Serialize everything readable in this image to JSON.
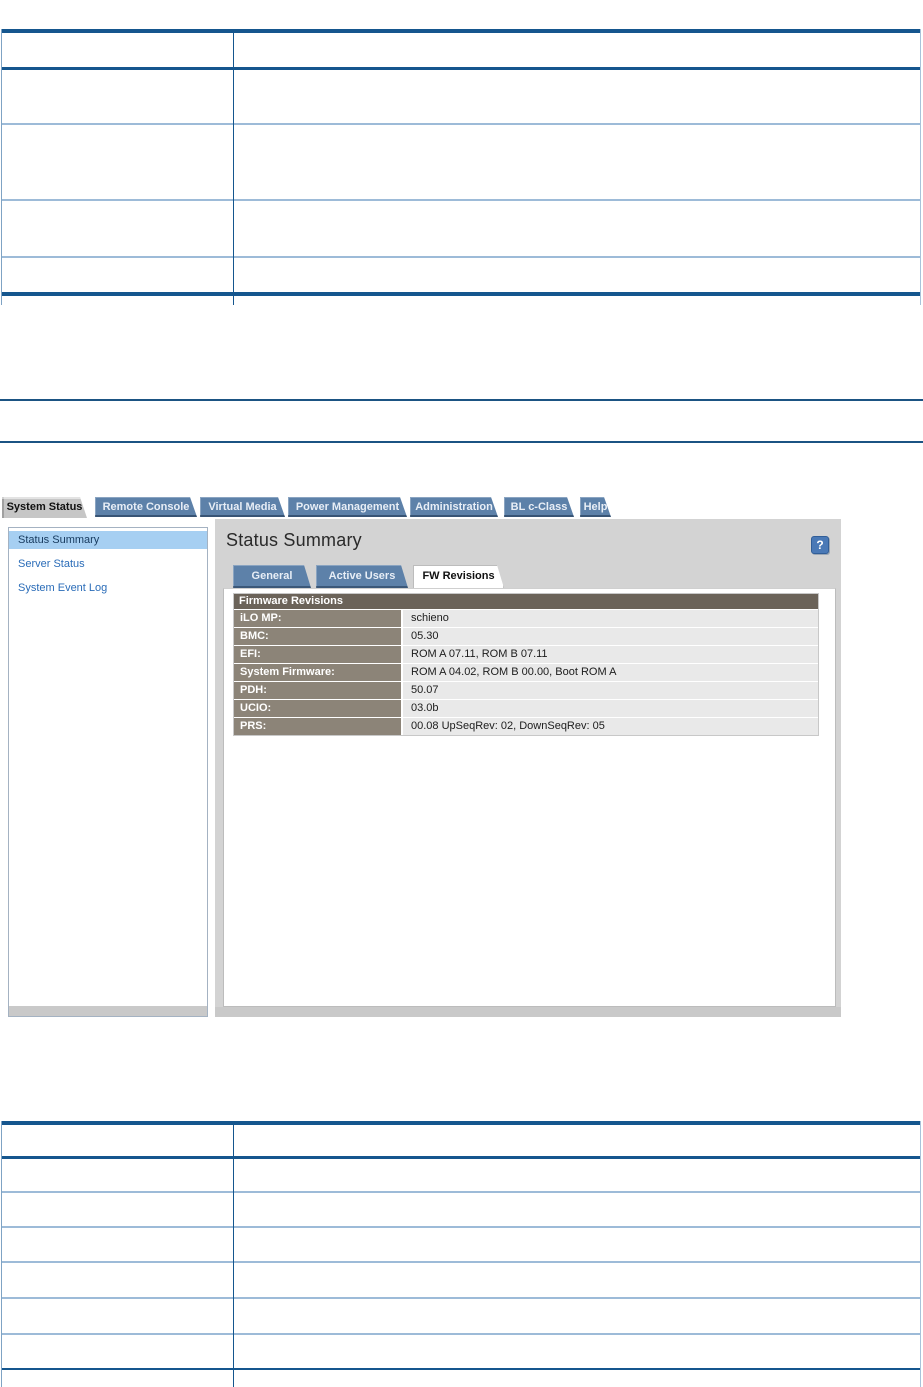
{
  "colors": {
    "table_border_dark": "#15568e",
    "table_border_light": "#9dbbd8",
    "rule_blue": "#1b5383",
    "tab_blue": "#5d81a9",
    "tab_active_gray": "#c6c6c6",
    "panel_gray": "#d3d3d3",
    "sidebar_highlight": "#a6cff2",
    "link_blue": "#2a6cb8",
    "fw_header_bg": "#6b6359",
    "fw_label_bg": "#8c8478",
    "fw_value_bg": "#e9e9e9",
    "help_button_bg": "#4a79b6"
  },
  "screenshot": {
    "tabs": [
      {
        "label": "System Status",
        "active": true
      },
      {
        "label": "Remote Console",
        "active": false
      },
      {
        "label": "Virtual Media",
        "active": false
      },
      {
        "label": "Power Management",
        "active": false
      },
      {
        "label": "Administration",
        "active": false
      },
      {
        "label": "BL c-Class",
        "active": false
      },
      {
        "label": "Help",
        "active": false
      }
    ],
    "sidebar": {
      "items": [
        {
          "label": "Status Summary",
          "active": true
        },
        {
          "label": "Server Status",
          "active": false
        },
        {
          "label": "System Event Log",
          "active": false
        }
      ]
    },
    "main": {
      "title": "Status Summary",
      "help_label": "?",
      "subtabs": [
        {
          "label": "General",
          "active": false
        },
        {
          "label": "Active Users",
          "active": false
        },
        {
          "label": "FW Revisions",
          "active": true
        }
      ],
      "fw_table": {
        "header": "Firmware Revisions",
        "rows": [
          {
            "label": "iLO MP:",
            "value": "schieno"
          },
          {
            "label": "BMC:",
            "value": "05.30"
          },
          {
            "label": "EFI:",
            "value": "ROM A 07.11, ROM B 07.11"
          },
          {
            "label": "System Firmware:",
            "value": "ROM A 04.02, ROM B 00.00, Boot ROM A"
          },
          {
            "label": "PDH:",
            "value": "50.07"
          },
          {
            "label": "UCIO:",
            "value": "03.0b"
          },
          {
            "label": "PRS:",
            "value": "00.08 UpSeqRev: 02, DownSeqRev: 05"
          }
        ]
      }
    }
  }
}
